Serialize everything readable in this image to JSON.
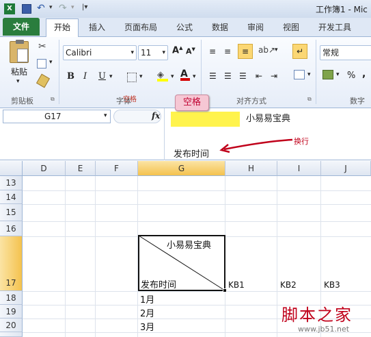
{
  "window": {
    "title": "工作簿1 - Mic"
  },
  "tabs": [
    "文件",
    "开始",
    "插入",
    "页面布局",
    "公式",
    "数据",
    "审阅",
    "视图",
    "开发工具"
  ],
  "ribbon": {
    "paste_label": "粘贴",
    "font_name": "Calibri",
    "font_size": "11",
    "bold": "B",
    "italic": "I",
    "underline": "U",
    "number_format": "常规",
    "group_clipboard": "剪贴板",
    "group_font": "字体",
    "group_alignment": "对齐方式",
    "group_number": "数字",
    "percent": "%",
    "comma": ","
  },
  "formula": {
    "cell_ref": "G17",
    "fx": "fx",
    "line1": "小易易宝典",
    "line2": "发布时间"
  },
  "annotations": {
    "space": "空格",
    "newline": "换行",
    "overlap": "空格"
  },
  "columns": [
    "D",
    "E",
    "F",
    "G",
    "H",
    "I",
    "J"
  ],
  "rows": [
    "13",
    "14",
    "15",
    "16",
    "17",
    "18",
    "19",
    "20"
  ],
  "cells": {
    "g17_top": "小易易宝典",
    "g17_bottom": "发布时间",
    "h17": "KB1",
    "i17": "KB2",
    "j17": "KB3",
    "g18": "1月",
    "g19": "2月",
    "g20": "3月"
  },
  "watermark": {
    "text": "脚本之家",
    "url": "www.jb51.net"
  },
  "colors": {
    "file_tab": "#2a7d3d",
    "highlight": "#fff34d",
    "selected_header": "#f8d57a"
  }
}
